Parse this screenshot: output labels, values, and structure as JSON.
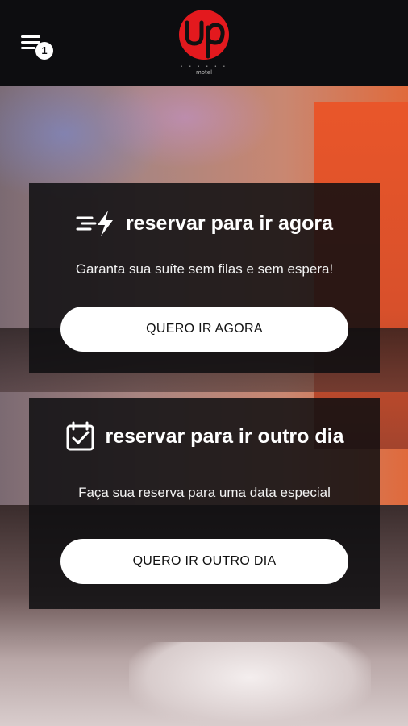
{
  "header": {
    "menu_badge_count": "1",
    "logo_text": "up",
    "logo_subtext": "motel"
  },
  "cards": [
    {
      "title": "reservar para ir agora",
      "icon": "fast-lightning-icon",
      "subtitle": "Garanta sua suíte sem filas e sem espera!",
      "button_label": "QUERO IR AGORA"
    },
    {
      "title": "reservar para ir outro dia",
      "icon": "calendar-check-icon",
      "subtitle": "Faça sua reserva para uma data especial",
      "button_label": "QUERO IR OUTRO DIA"
    }
  ],
  "colors": {
    "brand_red": "#e3191e",
    "topbar": "#0d0d10",
    "card_bg": "rgba(14,14,16,0.86)",
    "button_bg": "#ffffff"
  }
}
